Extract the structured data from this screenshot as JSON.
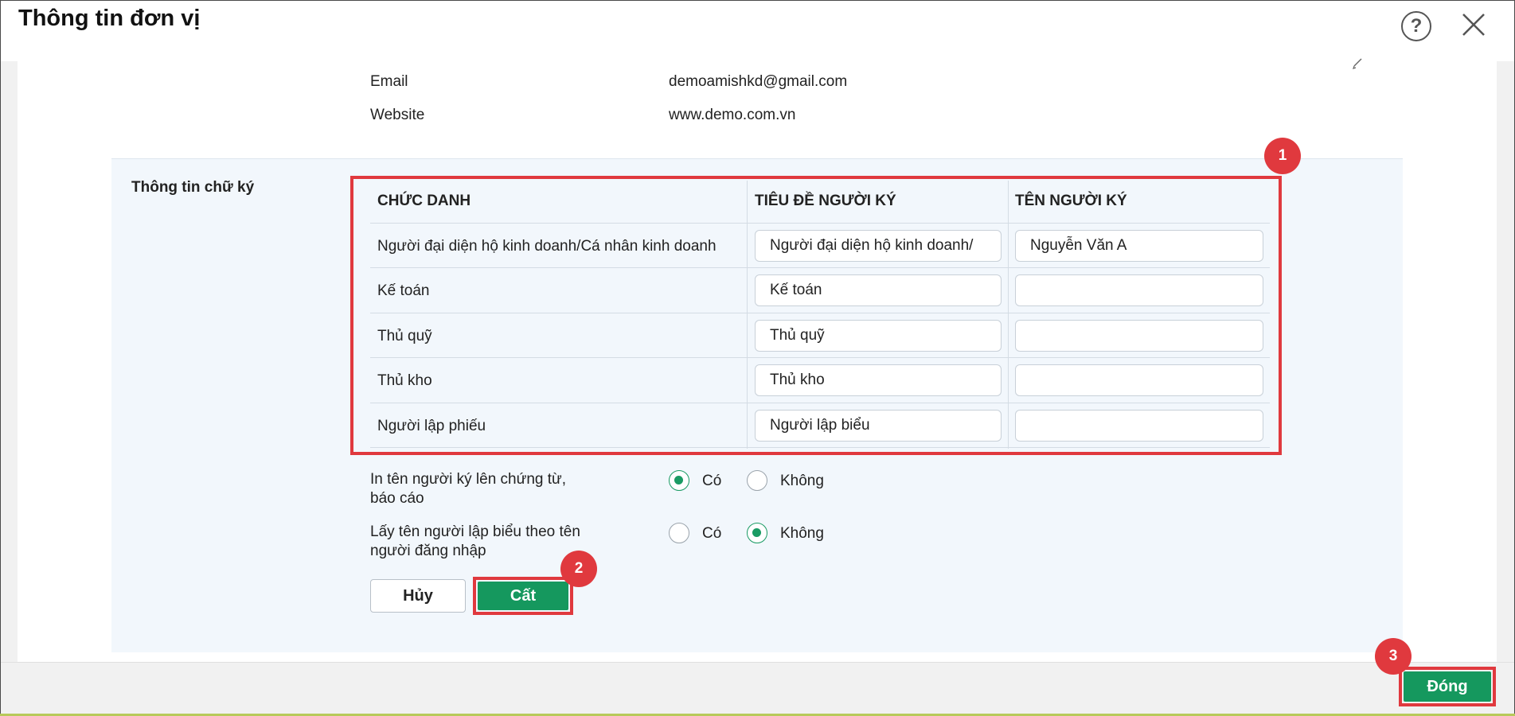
{
  "dialog": {
    "title": "Thông tin đơn vị",
    "help_glyph": "?",
    "icons": {
      "help": "help-circle-icon",
      "close": "close-icon",
      "edit": "pen-icon"
    }
  },
  "contact": {
    "email_label": "Email",
    "email_value": "demoamishkd@gmail.com",
    "website_label": "Website",
    "website_value": "www.demo.com.vn"
  },
  "signature": {
    "section_label": "Thông tin chữ ký",
    "headers": [
      "CHỨC DANH",
      "TIÊU ĐỀ NGƯỜI KÝ",
      "TÊN NGƯỜI KÝ"
    ],
    "rows": [
      {
        "position": "Người đại diện hộ kinh doanh/Cá nhân kinh doanh",
        "title": "Người đại diện hộ kinh doanh/",
        "name": "Nguyễn Văn A"
      },
      {
        "position": "Kế toán",
        "title": "Kế toán",
        "name": ""
      },
      {
        "position": "Thủ quỹ",
        "title": "Thủ quỹ",
        "name": ""
      },
      {
        "position": "Thủ kho",
        "title": "Thủ kho",
        "name": ""
      },
      {
        "position": "Người lập phiếu",
        "title": "Người lập biểu",
        "name": ""
      }
    ]
  },
  "options": [
    {
      "label_line1": "In tên người ký lên chứng từ,",
      "label_line2": "báo cáo",
      "yes": "Có",
      "no": "Không",
      "selected": "yes"
    },
    {
      "label_line1": "Lấy tên người lập biểu theo tên",
      "label_line2": "người đăng nhập",
      "yes": "Có",
      "no": "Không",
      "selected": "no"
    }
  ],
  "buttons": {
    "cancel": "Hủy",
    "save": "Cất",
    "close": "Đóng"
  },
  "badges": [
    "1",
    "2",
    "3"
  ],
  "colors": {
    "accent_green": "#15985e",
    "highlight_red": "#e0393e",
    "section_bg": "#f2f7fc"
  }
}
